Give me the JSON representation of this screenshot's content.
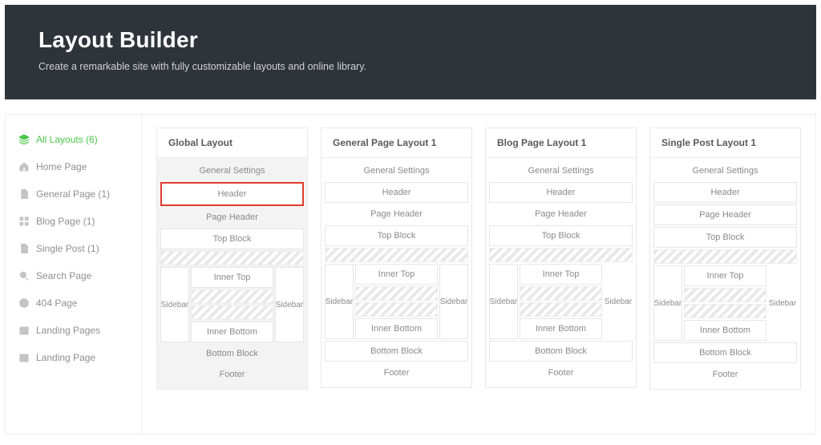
{
  "hero": {
    "title": "Layout Builder",
    "subtitle": "Create a remarkable site with fully customizable layouts and online library."
  },
  "sidebar": {
    "items": [
      {
        "label": "All Layouts (6)",
        "icon": "layers"
      },
      {
        "label": "Home Page",
        "icon": "home"
      },
      {
        "label": "General Page (1)",
        "icon": "file"
      },
      {
        "label": "Blog Page (1)",
        "icon": "grid"
      },
      {
        "label": "Single Post (1)",
        "icon": "file"
      },
      {
        "label": "Search Page",
        "icon": "search"
      },
      {
        "label": "404 Page",
        "icon": "globe"
      },
      {
        "label": "Landing Pages",
        "icon": "calendar"
      },
      {
        "label": "Landing Page",
        "icon": "calendar"
      }
    ]
  },
  "cards": [
    {
      "title": "Global Layout"
    },
    {
      "title": "General Page Layout 1"
    },
    {
      "title": "Blog Page Layout 1"
    },
    {
      "title": "Single Post Layout 1"
    }
  ],
  "slots": {
    "general_settings": "General Settings",
    "header": "Header",
    "page_header": "Page Header",
    "top_block": "Top Block",
    "inner_top": "Inner Top",
    "sidebar": "Sidebar",
    "inner_bottom": "Inner Bottom",
    "bottom_block": "Bottom Block",
    "footer": "Footer"
  }
}
